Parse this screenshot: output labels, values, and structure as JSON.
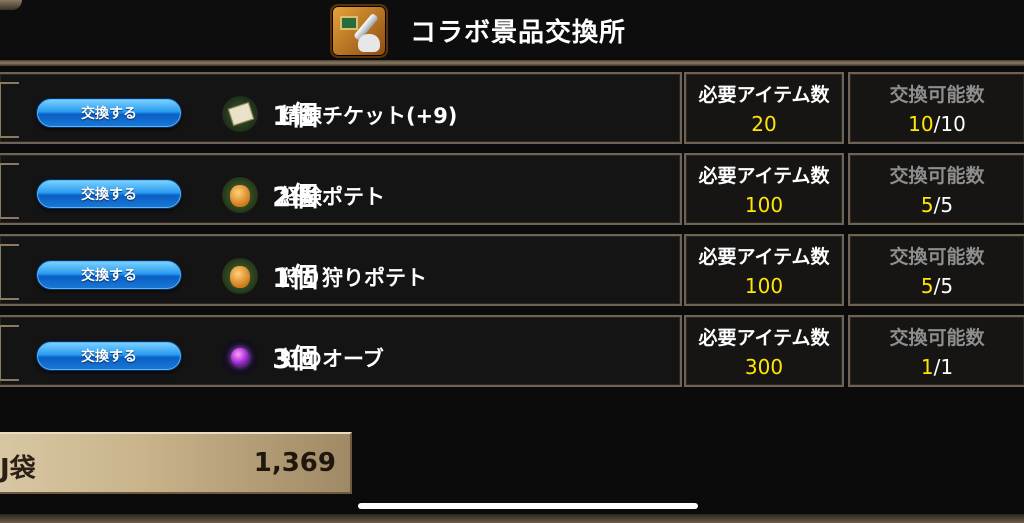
{
  "header": {
    "title": "コラボ景品交換所",
    "icon": "collab-exchange-icon"
  },
  "exchange_button_label": "交換する",
  "items": [
    {
      "name": "精錬チケット(+9)",
      "quantity": "1個",
      "icon": "ticket-icon",
      "required_label": "必要アイテム数",
      "required_value": "20",
      "available_label": "交換可能数",
      "available_current": "10",
      "available_sep": "/",
      "available_max": "10"
    },
    {
      "name": "経験ポテト",
      "quantity": "2個",
      "icon": "potato-icon",
      "required_label": "必要アイテム数",
      "required_value": "100",
      "available_label": "交換可能数",
      "available_current": "5",
      "available_sep": "/",
      "available_max": "5"
    },
    {
      "name": "狩り狩りポテト",
      "quantity": "1個",
      "icon": "potato-icon",
      "required_label": "必要アイテム数",
      "required_value": "100",
      "available_label": "交換可能数",
      "available_current": "5",
      "available_sep": "/",
      "available_max": "5"
    },
    {
      "name": "虹のオーブ",
      "quantity": "3個",
      "icon": "orb-icon",
      "required_label": "必要アイテム数",
      "required_value": "300",
      "available_label": "交換可能数",
      "available_current": "1",
      "available_sep": "/",
      "available_max": "1"
    }
  ],
  "footer": {
    "bag_label": "J袋",
    "bag_value": "1,369"
  },
  "colors": {
    "accent_yellow": "#ffe600",
    "button_blue": "#1b79d8",
    "frame": "#6e6354"
  }
}
